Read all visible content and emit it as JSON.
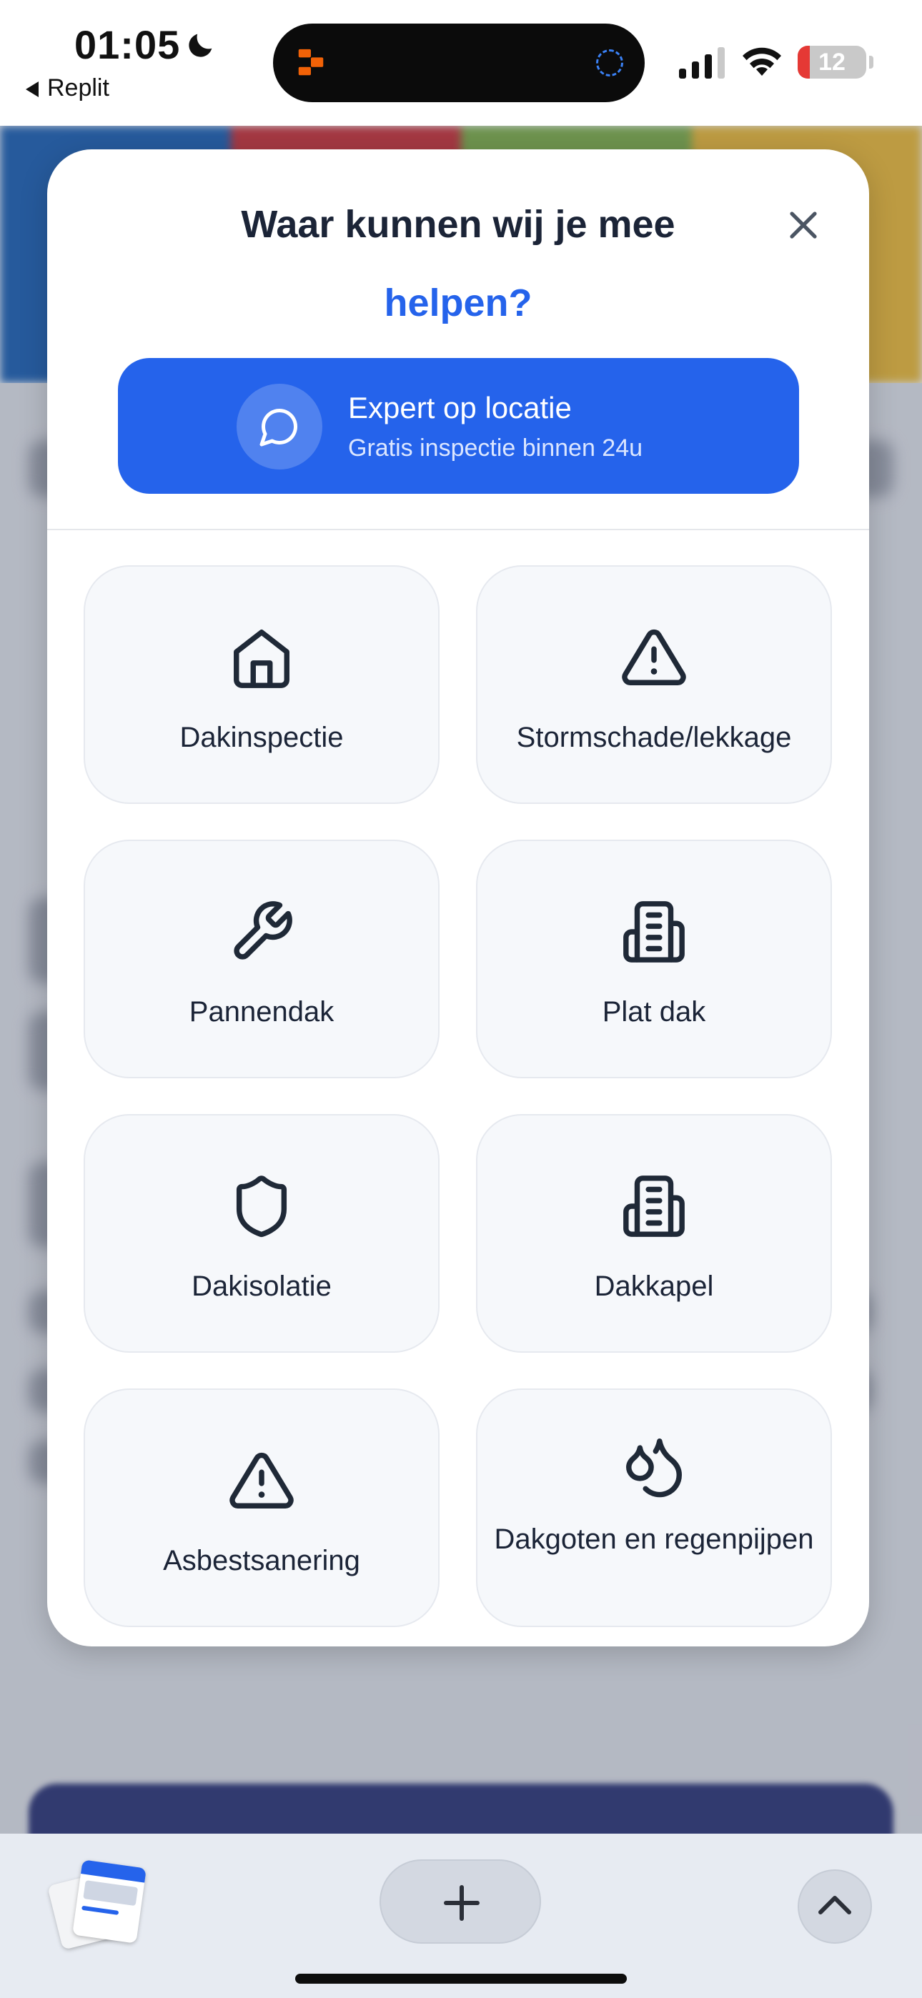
{
  "status_bar": {
    "time": "01:05",
    "back_app": "Replit",
    "battery_level": "12"
  },
  "modal": {
    "title_line1": "Waar kunnen wij je mee",
    "title_line2": "helpen?",
    "close_icon": "x-icon",
    "expert": {
      "title": "Expert op locatie",
      "subtitle": "Gratis inspectie binnen 24u",
      "icon": "chat-bubble-icon"
    },
    "tiles": [
      {
        "label": "Dakinspectie",
        "icon": "home-icon"
      },
      {
        "label": "Stormschade/lekkage",
        "icon": "alert-triangle-icon"
      },
      {
        "label": "Pannendak",
        "icon": "wrench-icon"
      },
      {
        "label": "Plat dak",
        "icon": "building-icon"
      },
      {
        "label": "Dakisolatie",
        "icon": "shield-icon"
      },
      {
        "label": "Dakkapel",
        "icon": "building-icon"
      },
      {
        "label": "Asbestsanering",
        "icon": "alert-triangle-icon"
      },
      {
        "label": "Dakgoten en regenpijpen",
        "icon": "droplets-icon"
      }
    ]
  },
  "colors": {
    "accent": "#2563eb",
    "title_text": "#1b2437",
    "tile_bg": "#f6f8fb",
    "header_stripes": [
      "#0b4ea2",
      "#b3202a",
      "#6b9a3a",
      "#d4a52a"
    ]
  }
}
